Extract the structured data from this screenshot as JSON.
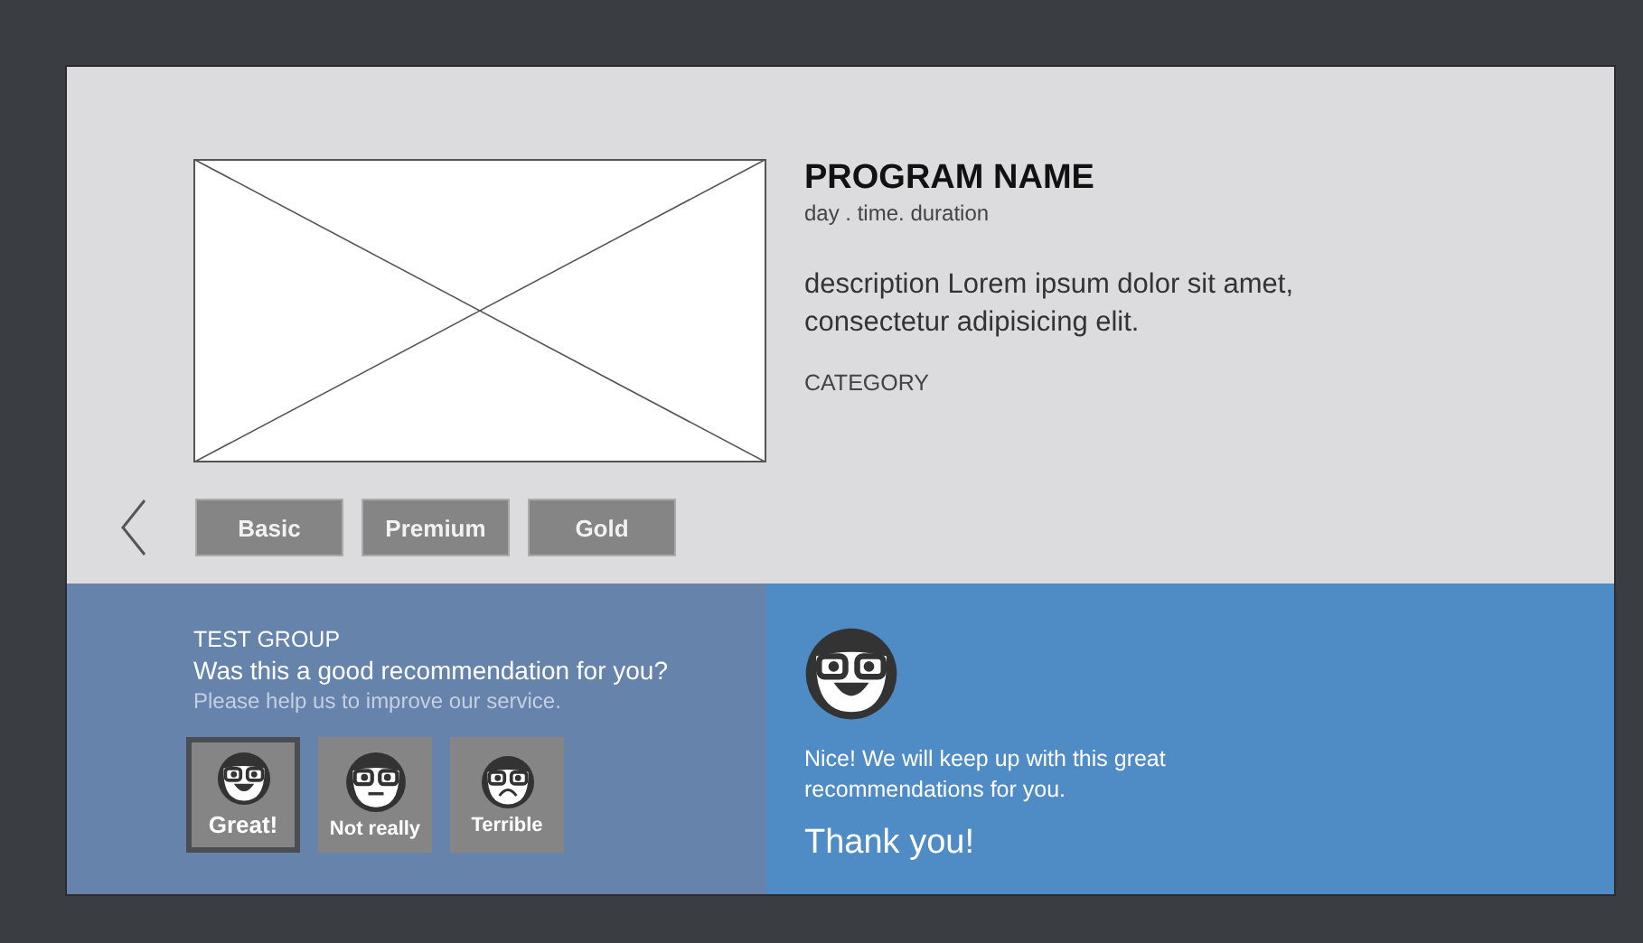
{
  "program": {
    "title": "PROGRAM NAME",
    "schedule": "day . time. duration",
    "description": "description Lorem ipsum dolor sit amet, consectetur adipisicing elit.",
    "category": "CATEGORY"
  },
  "tiers": [
    {
      "label": "Basic"
    },
    {
      "label": "Premium"
    },
    {
      "label": "Gold"
    }
  ],
  "feedback": {
    "group": "TEST GROUP",
    "question": "Was this a good recommendation for you?",
    "hint": "Please help us to improve our service.",
    "options": [
      {
        "label": "Great!",
        "kind": "happy",
        "selected": true
      },
      {
        "label": "Not really",
        "kind": "neutral",
        "selected": false
      },
      {
        "label": "Terrible",
        "kind": "sad",
        "selected": false
      }
    ]
  },
  "response": {
    "kind": "happy",
    "message": "Nice! We will keep up with this great recommendations for you.",
    "thanks": "Thank you!"
  }
}
